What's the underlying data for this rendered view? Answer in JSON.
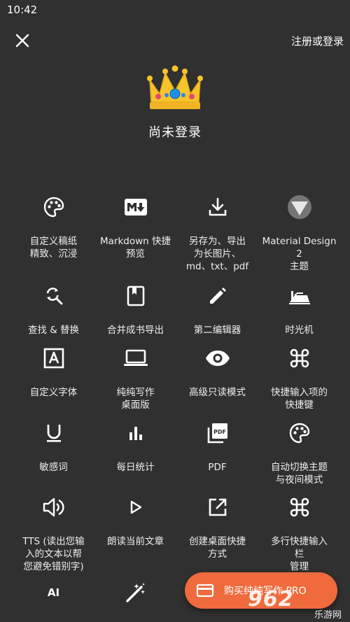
{
  "status_bar": {
    "time": "10:42"
  },
  "header": {
    "login_link": "注册或登录"
  },
  "profile": {
    "status": "尚未登录"
  },
  "features": [
    [
      {
        "label": "自定义稿纸\n精致、沉浸"
      },
      {
        "label": "Markdown 快捷\n预览"
      },
      {
        "label": "另存为、导出\n为长图片、\nmd、txt、pdf"
      },
      {
        "label": "Material Design\n2\n主题"
      }
    ],
    [
      {
        "label": "查找 & 替换"
      },
      {
        "label": "合并成书导出"
      },
      {
        "label": "第二编辑器"
      },
      {
        "label": "时光机"
      }
    ],
    [
      {
        "label": "自定义字体"
      },
      {
        "label": "纯纯写作\n桌面版"
      },
      {
        "label": "高级只读模式"
      },
      {
        "label": "快捷输入项的\n快捷键"
      }
    ],
    [
      {
        "label": "敏感词"
      },
      {
        "label": "每日统计"
      },
      {
        "label": "PDF"
      },
      {
        "label": "自动切换主题\n与夜间模式"
      }
    ],
    [
      {
        "label": "TTS (读出您输\n入的文本以帮\n您避免错别字)"
      },
      {
        "label": "朗读当前文章"
      },
      {
        "label": "创建桌面快捷\n方式"
      },
      {
        "label": "多行快捷输入\n栏\n管理"
      }
    ]
  ],
  "partial_row": {
    "ai_label": "AI"
  },
  "buy_button": {
    "label": "购买纯纯写作 PRO"
  },
  "watermark": {
    "text": "962",
    "sub": "乐游网"
  },
  "colors": {
    "background": "#303030",
    "accent": "#ef6a3c"
  }
}
